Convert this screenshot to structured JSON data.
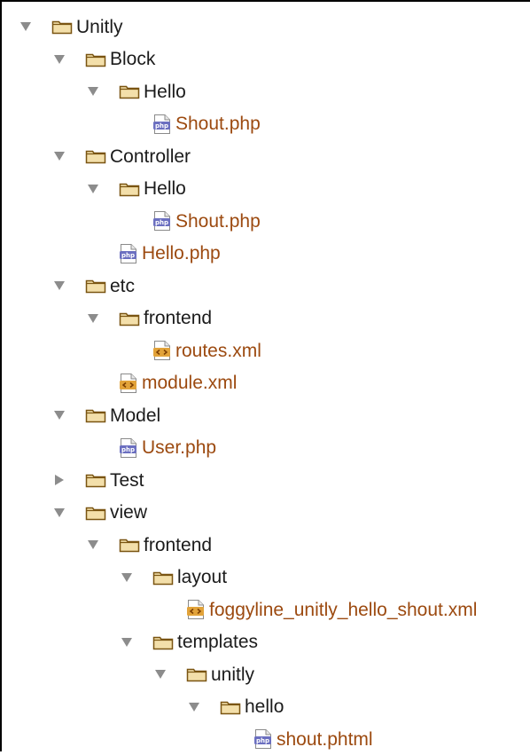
{
  "tree": [
    {
      "label": "Unitly",
      "kind": "folder",
      "depth": 0,
      "state": "expanded"
    },
    {
      "label": "Block",
      "kind": "folder",
      "depth": 1,
      "state": "expanded"
    },
    {
      "label": "Hello",
      "kind": "folder",
      "depth": 2,
      "state": "expanded"
    },
    {
      "label": "Shout.php",
      "kind": "file",
      "icon": "php-file-icon",
      "depth": 3
    },
    {
      "label": "Controller",
      "kind": "folder",
      "depth": 1,
      "state": "expanded"
    },
    {
      "label": "Hello",
      "kind": "folder",
      "depth": 2,
      "state": "expanded"
    },
    {
      "label": "Shout.php",
      "kind": "file",
      "icon": "php-file-icon",
      "depth": 3
    },
    {
      "label": "Hello.php",
      "kind": "file",
      "icon": "php-file-icon",
      "depth": 2
    },
    {
      "label": "etc",
      "kind": "folder",
      "depth": 1,
      "state": "expanded"
    },
    {
      "label": "frontend",
      "kind": "folder",
      "depth": 2,
      "state": "expanded"
    },
    {
      "label": "routes.xml",
      "kind": "file",
      "icon": "xml-file-icon",
      "depth": 3
    },
    {
      "label": "module.xml",
      "kind": "file",
      "icon": "xml-file-icon",
      "depth": 2
    },
    {
      "label": "Model",
      "kind": "folder",
      "depth": 1,
      "state": "expanded"
    },
    {
      "label": "User.php",
      "kind": "file",
      "icon": "php-file-icon",
      "depth": 2
    },
    {
      "label": "Test",
      "kind": "folder",
      "depth": 1,
      "state": "collapsed"
    },
    {
      "label": "view",
      "kind": "folder",
      "depth": 1,
      "state": "expanded"
    },
    {
      "label": "frontend",
      "kind": "folder",
      "depth": 2,
      "state": "expanded"
    },
    {
      "label": "layout",
      "kind": "folder",
      "depth": 3,
      "state": "expanded"
    },
    {
      "label": "foggyline_unitly_hello_shout.xml",
      "kind": "file",
      "icon": "xml-file-icon",
      "depth": 4
    },
    {
      "label": "templates",
      "kind": "folder",
      "depth": 3,
      "state": "expanded"
    },
    {
      "label": "unitly",
      "kind": "folder",
      "depth": 4,
      "state": "expanded"
    },
    {
      "label": "hello",
      "kind": "folder",
      "depth": 5,
      "state": "expanded"
    },
    {
      "label": "shout.phtml",
      "kind": "file",
      "icon": "php-file-icon",
      "depth": 6
    }
  ],
  "colors": {
    "folder_fill": "#f3dfaa",
    "folder_stroke": "#7a5512",
    "file_text": "#9c4a10",
    "folder_text": "#1b1b1b",
    "toggle": "#8c8c8c",
    "php_badge": "#6b6fc0",
    "xml_badge": "#e2a33a"
  }
}
